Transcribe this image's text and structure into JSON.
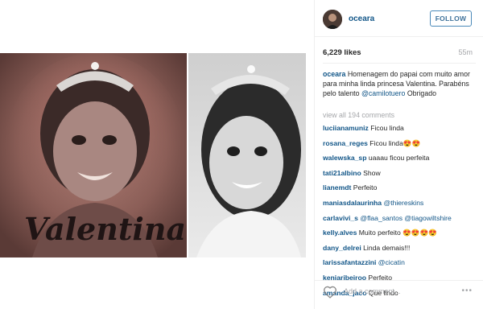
{
  "header": {
    "username": "oceara",
    "follow_label": "FOLLOW"
  },
  "stats": {
    "likes": "6,229 likes",
    "age": "55m"
  },
  "caption": {
    "username": "oceara",
    "text": "Homenagem do papai com muito amor para minha linda princesa Valentina. Parabéns pelo talento",
    "mention": "@camilotuero",
    "tail": "Obrigado"
  },
  "view_all": "view all 194 comments",
  "comments": [
    {
      "user": "luciianamuniz",
      "text": "Ficou linda"
    },
    {
      "user": "rosana_reges",
      "text": "Ficou linda😍😍"
    },
    {
      "user": "walewska_sp",
      "text": "uaaau ficou perfeita"
    },
    {
      "user": "tati21albino",
      "text": "Show"
    },
    {
      "user": "lianemdt",
      "text": "Perfeito"
    },
    {
      "user": "maniasdalaurinha",
      "text": "@thiereskins"
    },
    {
      "user": "carlavivi_s",
      "text": "@flaa_santos @tiagowiltshire"
    },
    {
      "user": "kelly.alves",
      "text": "Muito perfeito 😍😍😍😍"
    },
    {
      "user": "dany_delrei",
      "text": "Linda demais!!!"
    },
    {
      "user": "larissafantazzini",
      "text": "@cicatin"
    },
    {
      "user": "keniaribeiroo",
      "text": "Perfeito"
    },
    {
      "user": "amanda_jaco",
      "text": "Que lindo"
    }
  ],
  "footer": {
    "add_comment_placeholder": "Add a comment...",
    "more_label": "•••",
    "icons": [
      "heart-icon",
      "more-options-icon"
    ]
  },
  "photo": {
    "tattoo_script": "Valentina"
  }
}
